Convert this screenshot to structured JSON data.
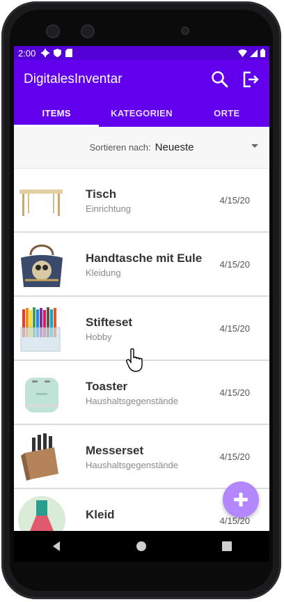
{
  "status_bar": {
    "time": "2:00"
  },
  "app_bar": {
    "title": "DigitalesInventar"
  },
  "tabs": [
    {
      "label": "ITEMS"
    },
    {
      "label": "KATEGORIEN"
    },
    {
      "label": "ORTE"
    }
  ],
  "sort": {
    "label": "Sortieren nach:",
    "value": "Neueste"
  },
  "items": [
    {
      "title": "Tisch",
      "category": "Einrichtung",
      "date": "4/15/20",
      "icon": "table-image"
    },
    {
      "title": "Handtasche mit Eule",
      "category": "Kleidung",
      "date": "4/15/20",
      "icon": "handbag-image"
    },
    {
      "title": "Stifteset",
      "category": "Hobby",
      "date": "4/15/20",
      "icon": "pen-set-image"
    },
    {
      "title": "Toaster",
      "category": "Haushaltsgegenstände",
      "date": "4/15/20",
      "icon": "toaster-image"
    },
    {
      "title": "Messerset",
      "category": "Haushaltsgegenstände",
      "date": "4/15/20",
      "icon": "knife-block-image"
    },
    {
      "title": "Kleid",
      "category": "",
      "date": "4/15/20",
      "icon": "dress-image"
    }
  ],
  "colors": {
    "primary": "#6200ee",
    "status_bar": "#5200d6",
    "fab": "#b388ff"
  }
}
